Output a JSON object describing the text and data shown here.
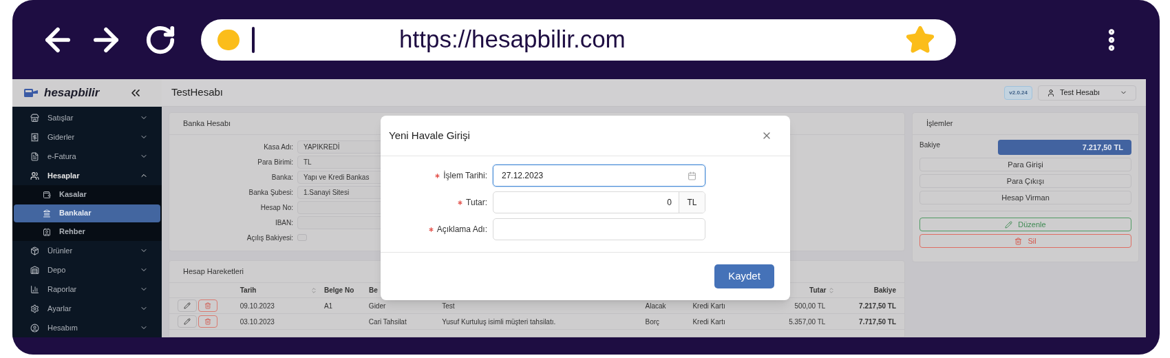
{
  "browser": {
    "url": "https://hesapbilir.com"
  },
  "app": {
    "logo": "hesapbilir",
    "page_title": "TestHesabı",
    "version": "v2.0.24",
    "user": "Test Hesabı"
  },
  "sidebar": {
    "items": [
      {
        "label": "Satışlar",
        "expanded": false
      },
      {
        "label": "Giderler",
        "expanded": false
      },
      {
        "label": "e-Fatura",
        "expanded": false
      },
      {
        "label": "Hesaplar",
        "expanded": true,
        "children": [
          {
            "label": "Kasalar",
            "selected": false
          },
          {
            "label": "Bankalar",
            "selected": true
          },
          {
            "label": "Rehber",
            "selected": false
          }
        ]
      },
      {
        "label": "Ürünler",
        "expanded": false
      },
      {
        "label": "Depo",
        "expanded": false
      },
      {
        "label": "Raporlar",
        "expanded": false
      },
      {
        "label": "Ayarlar",
        "expanded": false
      },
      {
        "label": "Hesabım",
        "expanded": false
      }
    ]
  },
  "bank_account": {
    "title": "Banka Hesabı",
    "fields": [
      {
        "label": "Kasa Adı:",
        "kind": "text",
        "value": "YAPIKREDİ"
      },
      {
        "label": "Para Birimi:",
        "kind": "text",
        "value": "TL"
      },
      {
        "label": "Banka:",
        "kind": "text",
        "value": "Yapı ve Kredi Bankas"
      },
      {
        "label": "Banka Şubesi:",
        "kind": "text",
        "value": "1.Sanayi Sitesi"
      },
      {
        "label": "Hesap No:",
        "kind": "text"
      },
      {
        "label": "IBAN:",
        "kind": "text"
      },
      {
        "label": "Açılış Bakiyesi:",
        "kind": "checkbox",
        "checked": false
      }
    ]
  },
  "transactions": {
    "title": "Hesap Hareketleri",
    "header": {
      "date": "Tarih",
      "doc_no": "Belge No",
      "column_4": "Be",
      "amount": "Tutar",
      "balance": "Bakiye"
    },
    "rows": [
      {
        "date": "09.10.2023",
        "doc_no": "A1",
        "column_4": "Gider",
        "description": "Test",
        "direction": "Alacak",
        "payment": "Kredi Kartı",
        "amount": "500,00 TL",
        "balance": "7.217,50 TL"
      },
      {
        "date": "03.10.2023",
        "column_4": "Cari Tahsilat",
        "description": "Yusuf Kurtuluş isimli müşteri tahsilatı.",
        "direction": "Borç",
        "payment": "Kredi Kartı",
        "amount": "5.357,00 TL",
        "balance": "7.717,50 TL"
      }
    ]
  },
  "operations": {
    "title": "İşlemler",
    "balance_label": "Bakiye",
    "balance": "7.217,50 TL",
    "buttons": [
      {
        "label": "Para Girişi",
        "kind": "plain"
      },
      {
        "label": "Para Çıkışı",
        "kind": "plain"
      },
      {
        "label": "Hesap Virman",
        "kind": "plain"
      },
      {
        "label": "Düzenle",
        "kind": "edit"
      },
      {
        "label": "Sil",
        "kind": "delete"
      }
    ]
  },
  "modal": {
    "title": "Yeni Havale Girişi",
    "fields": [
      {
        "label": "İşlem Tarihi:",
        "required": true,
        "kind": "date",
        "value": "27.12.2023",
        "focused": true
      },
      {
        "label": "Tutar:",
        "required": true,
        "kind": "amount",
        "value": "0",
        "suffix": "TL",
        "focused": false
      },
      {
        "label": "Açıklama Adı:",
        "required": true,
        "kind": "text",
        "focused": false
      }
    ],
    "submit": "Kaydet"
  }
}
